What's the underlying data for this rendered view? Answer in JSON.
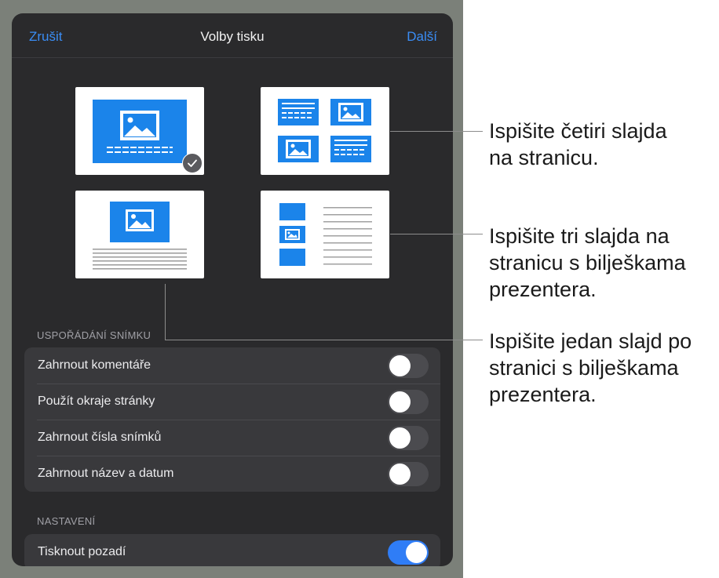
{
  "nav": {
    "cancel_label": "Zrušit",
    "title": "Volby tisku",
    "next_label": "Další"
  },
  "layouts": [
    {
      "id": "single-slide",
      "selected": true
    },
    {
      "id": "four-slides",
      "selected": false
    },
    {
      "id": "slide-with-notes",
      "selected": false
    },
    {
      "id": "three-slides-with-notes",
      "selected": false
    }
  ],
  "sections": {
    "slide_layout": {
      "header": "USPOŘÁDÁNÍ SNÍMKU",
      "rows": [
        {
          "label": "Zahrnout komentáře",
          "on": false
        },
        {
          "label": "Použít okraje stránky",
          "on": false
        },
        {
          "label": "Zahrnout čísla snímků",
          "on": false
        },
        {
          "label": "Zahrnout název a datum",
          "on": false
        }
      ]
    },
    "settings": {
      "header": "NASTAVENÍ",
      "rows": [
        {
          "label": "Tisknout pozadí",
          "on": true
        }
      ]
    }
  },
  "callouts": {
    "four_slides": [
      "Ispišite četiri slajda",
      "na stranicu."
    ],
    "three_slides": [
      "Ispišite tri slajda na",
      "stranicu s bilješkama",
      "prezentera."
    ],
    "one_slide": [
      "Ispišite jedan slajd po",
      "stranici s bilješkama",
      "prezentera."
    ]
  },
  "colors": {
    "accent": "#3a8df5",
    "slide_blue": "#1b84ea",
    "toggle_on": "#2f7df6",
    "panel_bg": "#2a2a2c"
  }
}
